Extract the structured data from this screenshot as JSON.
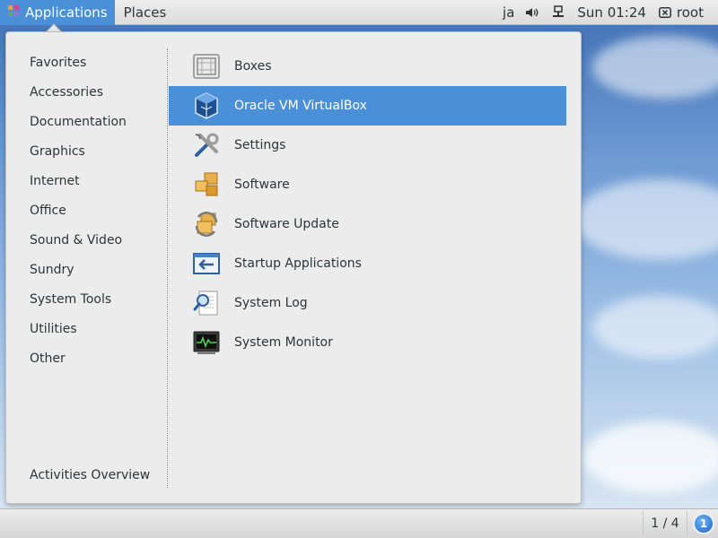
{
  "topbar": {
    "applications_label": "Applications",
    "places_label": "Places",
    "input_language": "ja",
    "clock": "Sun 01:24",
    "user": "root"
  },
  "menu": {
    "categories": [
      {
        "label": "Favorites"
      },
      {
        "label": "Accessories"
      },
      {
        "label": "Documentation"
      },
      {
        "label": "Graphics"
      },
      {
        "label": "Internet"
      },
      {
        "label": "Office"
      },
      {
        "label": "Sound & Video"
      },
      {
        "label": "Sundry"
      },
      {
        "label": "System Tools"
      },
      {
        "label": "Utilities"
      },
      {
        "label": "Other"
      }
    ],
    "activities_label": "Activities Overview",
    "apps": [
      {
        "label": "Boxes",
        "icon": "boxes-icon"
      },
      {
        "label": "Oracle VM VirtualBox",
        "icon": "virtualbox-icon",
        "selected": true
      },
      {
        "label": "Settings",
        "icon": "settings-icon"
      },
      {
        "label": "Software",
        "icon": "software-icon"
      },
      {
        "label": "Software Update",
        "icon": "software-update-icon"
      },
      {
        "label": "Startup Applications",
        "icon": "startup-applications-icon"
      },
      {
        "label": "System Log",
        "icon": "system-log-icon"
      },
      {
        "label": "System Monitor",
        "icon": "system-monitor-icon"
      }
    ]
  },
  "bottombar": {
    "workspace": "1 / 4",
    "notification_count": "1"
  },
  "colors": {
    "selection": "#4a90d9",
    "menu_bg": "#ececec"
  }
}
